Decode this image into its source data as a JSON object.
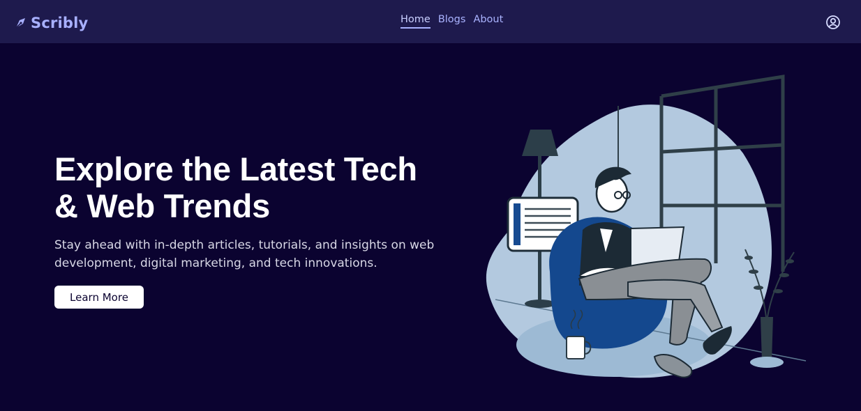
{
  "brand": {
    "name": "Scribly",
    "icon": "pen-nib-icon",
    "color": "#a8b0ff"
  },
  "nav": {
    "links": [
      {
        "label": "Home",
        "active": true
      },
      {
        "label": "Blogs",
        "active": false
      },
      {
        "label": "About",
        "active": false
      }
    ],
    "profile_icon": "user-circle-icon"
  },
  "hero": {
    "title_line1": "Explore the Latest Tech",
    "title_line2": "& Web Trends",
    "subtitle": "Stay ahead with in-depth articles, tutorials, and insights on web development, digital marketing, and tech innovations.",
    "cta_label": "Learn More"
  },
  "colors": {
    "page_bg": "#0b0330",
    "navbar_bg": "#1e1a4d",
    "accent": "#a8b0ff",
    "illustration_blob": "#b3c9df",
    "illustration_navy": "#14488e"
  }
}
